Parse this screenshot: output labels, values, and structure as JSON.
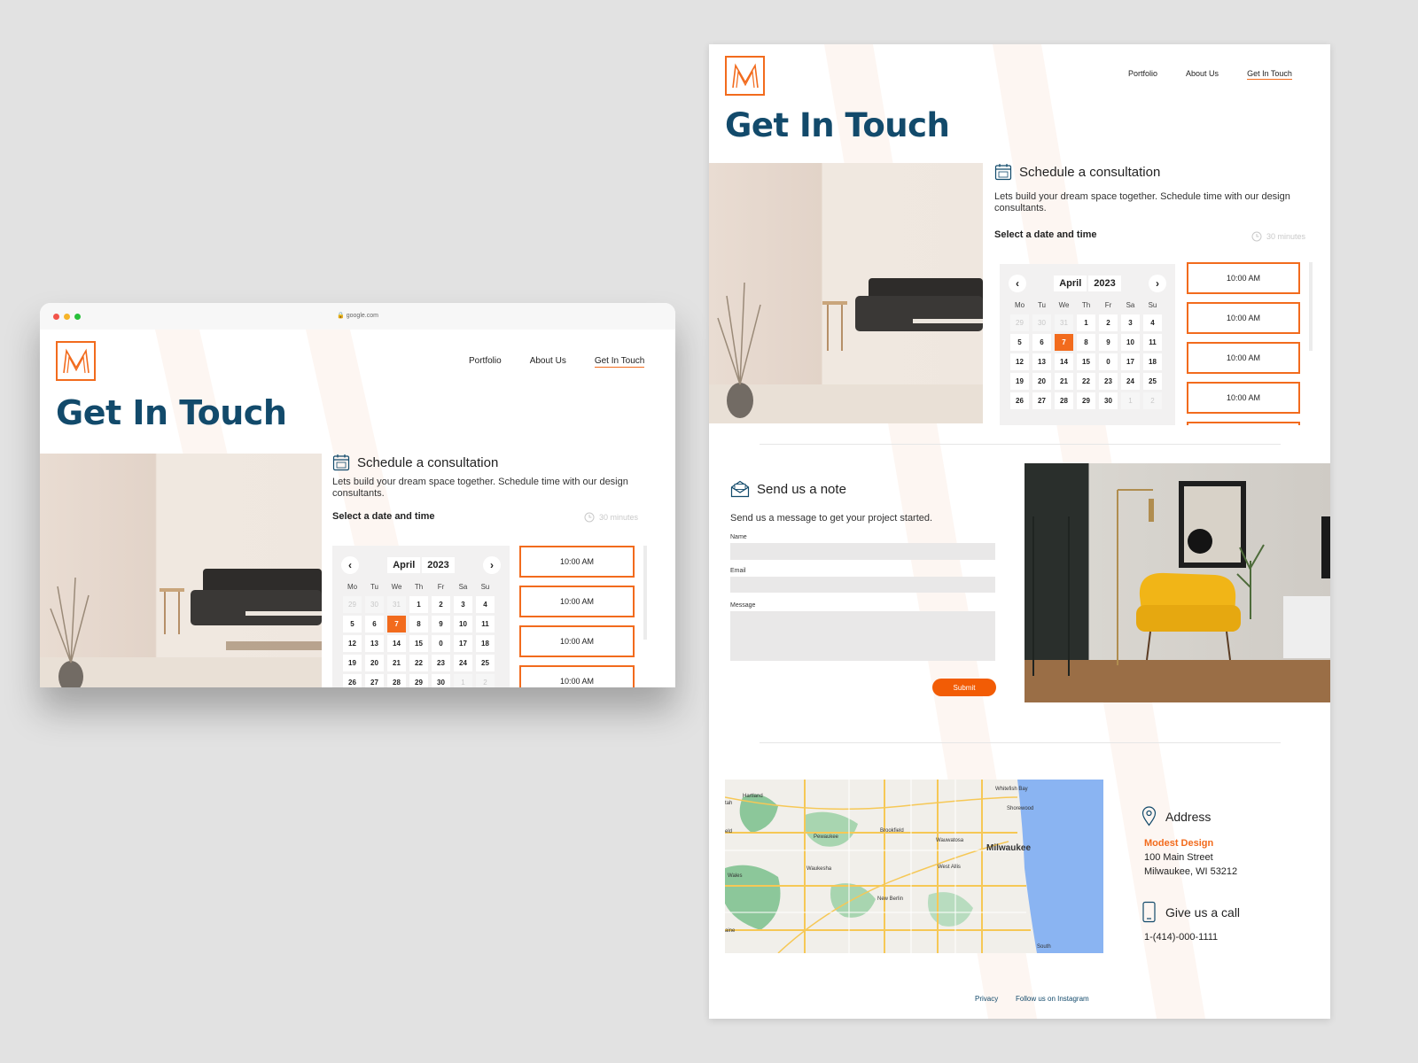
{
  "colors": {
    "accent": "#f26b1d",
    "title": "#124a6b",
    "field": "#e9e8e8",
    "background": "#e2e2e2"
  },
  "browser": {
    "url": "google.com"
  },
  "nav": {
    "items": [
      "Portfolio",
      "About Us",
      "Get In Touch"
    ],
    "active": "Get In Touch"
  },
  "page": {
    "title": "Get In Touch"
  },
  "schedule": {
    "title": "Schedule a consultation",
    "description": "Lets build your dream space together. Schedule time with our design consultants.",
    "select_label": "Select a date and time",
    "duration": "30 minutes",
    "icon": "calendar-icon"
  },
  "calendar": {
    "month": "April",
    "year": "2023",
    "weekdays": [
      "Mo",
      "Tu",
      "We",
      "Th",
      "Fr",
      "Sa",
      "Su"
    ],
    "selected": "7",
    "weeks": [
      [
        "29",
        "30",
        "31",
        "1",
        "2",
        "3",
        "4"
      ],
      [
        "5",
        "6",
        "7",
        "8",
        "9",
        "10",
        "11"
      ],
      [
        "12",
        "13",
        "14",
        "15",
        "0",
        "17",
        "18"
      ],
      [
        "19",
        "20",
        "21",
        "22",
        "23",
        "24",
        "25"
      ],
      [
        "26",
        "27",
        "28",
        "29",
        "30",
        "1",
        "2"
      ]
    ],
    "muted_leading": 3,
    "muted_trailing": 2
  },
  "time_slots": [
    "10:00 AM",
    "10:00 AM",
    "10:00 AM",
    "10:00 AM",
    "10:00 AM"
  ],
  "note": {
    "title": "Send us a note",
    "description": "Send us a message to get your project started.",
    "name_label": "Name",
    "email_label": "Email",
    "message_label": "Message",
    "submit_label": "Submit",
    "icon": "envelope-icon"
  },
  "map": {
    "labels": [
      "Hartland",
      "Pewaukee",
      "Brookfield",
      "Wauwatosa",
      "Whitefish Bay",
      "Shorewood",
      "Milwaukee",
      "Waukesha",
      "West Allis",
      "Wales",
      "New Berlin",
      "South",
      "tah",
      "eld",
      "aine"
    ]
  },
  "address": {
    "title": "Address",
    "company": "Modest Design",
    "street": "100 Main Street",
    "city": "Milwaukee, WI 53212",
    "icon": "map-pin-icon"
  },
  "call": {
    "title": "Give us a call",
    "phone": "1-(414)-000-1111",
    "icon": "phone-icon"
  },
  "footer": {
    "privacy": "Privacy",
    "instagram": "Follow us on Instagram"
  }
}
